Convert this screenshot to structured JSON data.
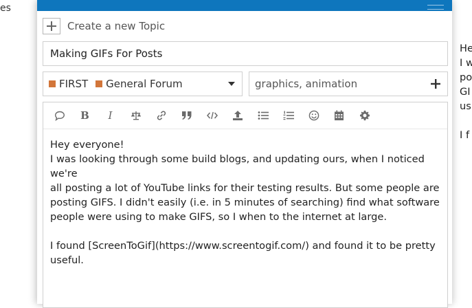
{
  "background": {
    "left_text": "es"
  },
  "composer": {
    "create_label": "Create a new Topic",
    "title_value": "Making GIFs For Posts",
    "category": {
      "parent": "FIRST",
      "child": "General Forum",
      "color": "#D2763A"
    },
    "tags_value": "graphics, animation",
    "accent_color": "#0E76BD",
    "toolbar": [
      {
        "name": "quote-icon"
      },
      {
        "name": "bold-icon",
        "glyph": "B"
      },
      {
        "name": "italic-icon",
        "glyph": "I"
      },
      {
        "name": "scale-icon"
      },
      {
        "name": "link-icon"
      },
      {
        "name": "blockquote-icon"
      },
      {
        "name": "code-icon"
      },
      {
        "name": "upload-icon"
      },
      {
        "name": "bullet-list-icon"
      },
      {
        "name": "numbered-list-icon"
      },
      {
        "name": "emoji-icon"
      },
      {
        "name": "calendar-icon"
      },
      {
        "name": "gear-icon"
      }
    ],
    "body_lines": [
      "Hey everyone!",
      "I was looking through some build blogs, and updating ours, when I noticed we're",
      "all posting a lot of YouTube links for their testing results. But some people are",
      "posting GIFS. I didn't easily (i.e. in 5 minutes of searching) find what software",
      "people were using to make GIFS, so I when to the internet at large.",
      "",
      "I found [ScreenToGif](https://www.screentogif.com/) and found it to be pretty",
      "useful."
    ]
  },
  "preview": {
    "lines": [
      "He",
      "I w",
      "po",
      "GI",
      "us",
      "",
      "I f"
    ]
  }
}
